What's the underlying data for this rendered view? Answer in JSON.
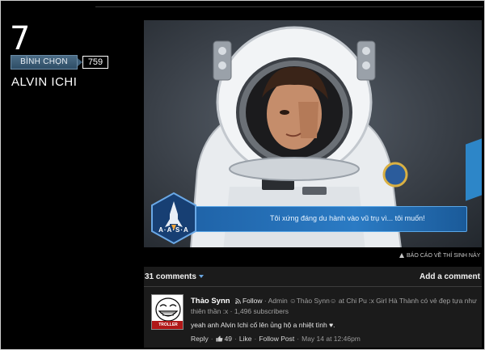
{
  "contestant": {
    "rank": "7",
    "vote_label": "BÌNH CHỌN",
    "vote_count": "759",
    "name": "ALVIN ICHI"
  },
  "photo": {
    "dialog_text": "Tôi xứng đáng du hành vào vũ trụ vì... tôi muốn!",
    "badge_label": "A·A·S·A"
  },
  "report": {
    "icon": "warning-icon",
    "label": "BÁO CÁO VỀ THÍ SINH NÀY"
  },
  "comments": {
    "count_label": "31 comments",
    "add_label": "Add a comment",
    "items": [
      {
        "author": "Thảo Synn",
        "follow_label": "Follow",
        "meta": "· Admin ☺Thảo Synn☺ at Chi Pu :x Girl Hà Thành có vẻ đẹp tựa như thiên thần :x · 1,496 subscribers",
        "body": "yeah anh Alvin Ichi cố lên ủng hộ a nhiệt tình ♥.",
        "avatar_label": "TROLLER",
        "reply_label": "Reply",
        "likes": "49",
        "like_label": "Like",
        "follow_post_label": "Follow Post",
        "timestamp": "May 14 at 12:46pm"
      }
    ]
  },
  "colors": {
    "accent_blue": "#2b7bc4",
    "vote_button": "#3d5e78",
    "troll_red": "#b01818"
  }
}
